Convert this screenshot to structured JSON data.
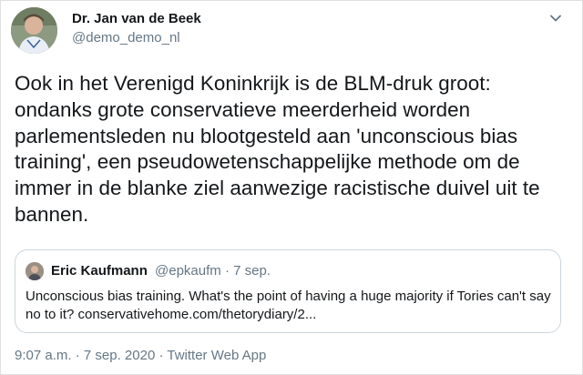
{
  "author": {
    "name": "Dr. Jan van de Beek",
    "handle": "@demo_demo_nl"
  },
  "tweet": {
    "text": "Ook in het Verenigd Koninkrijk is de BLM-druk groot: ondanks grote conservatieve meerderheid worden parlementsleden nu blootgesteld aan 'unconscious bias training', een pseudowetenschappelijke methode om de immer in de blanke ziel aanwezige racistische duivel uit te bannen."
  },
  "quoted": {
    "name": "Eric Kaufmann",
    "handle": "@epkaufm",
    "separator": "·",
    "date": "7 sep.",
    "text": "Unconscious bias training. What's the point of having a huge majority if Tories can't say no to it? conservativehome.com/thetorydiary/2..."
  },
  "footer": {
    "time": "9:07 a.m.",
    "sep1": "·",
    "date": "7 sep. 2020",
    "sep2": "·",
    "source": "Twitter Web App"
  },
  "icons": {
    "more": "chevron-down-icon",
    "avatar": "avatar",
    "quoted_avatar": "avatar"
  },
  "colors": {
    "text": "#14171a",
    "muted": "#657786",
    "border": "#ccd6dd"
  }
}
